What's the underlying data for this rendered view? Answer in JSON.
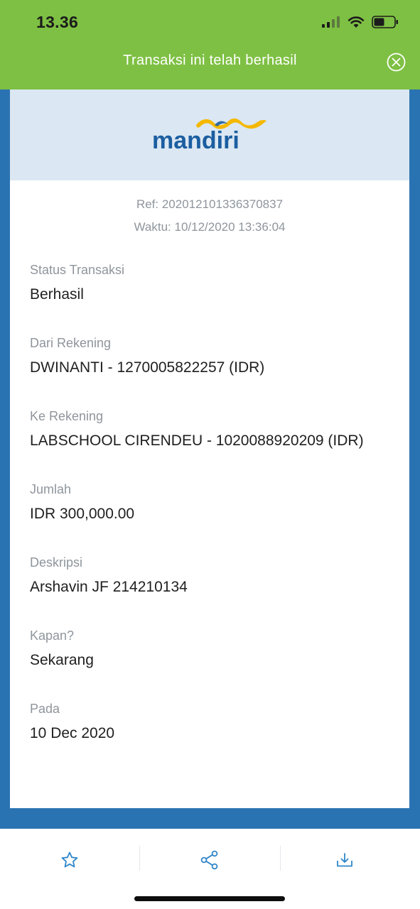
{
  "status_bar": {
    "time": "13.36",
    "icons": [
      "cellular-signal-icon",
      "wifi-icon",
      "battery-icon"
    ]
  },
  "banner": {
    "text": "Transaksi ini telah berhasil",
    "close_icon": "close-circle-icon"
  },
  "receipt": {
    "logo_text": "mandiri",
    "ref": "Ref: 202012101336370837",
    "time": "Waktu: 10/12/2020 13:36:04",
    "fields": [
      {
        "label": "Status Transaksi",
        "value": "Berhasil"
      },
      {
        "label": "Dari Rekening",
        "value": "DWINANTI - 1270005822257 (IDR)"
      },
      {
        "label": "Ke Rekening",
        "value": "LABSCHOOL CIRENDEU - 1020088920209 (IDR)"
      },
      {
        "label": "Jumlah",
        "value": "IDR 300,000.00"
      },
      {
        "label": "Deskripsi",
        "value": "Arshavin JF 214210134"
      },
      {
        "label": "Kapan?",
        "value": "Sekarang"
      },
      {
        "label": "Pada",
        "value": "10 Dec 2020"
      }
    ]
  },
  "toolbar": {
    "buttons": [
      "star-icon",
      "share-icon",
      "download-icon"
    ]
  },
  "colors": {
    "banner_green": "#7ec043",
    "frame_blue": "#2a73b2",
    "logo_band": "#dbe7f2",
    "brand_blue": "#1b5ea1",
    "brand_yellow": "#f5b800",
    "icon_blue": "#2f86c9"
  }
}
